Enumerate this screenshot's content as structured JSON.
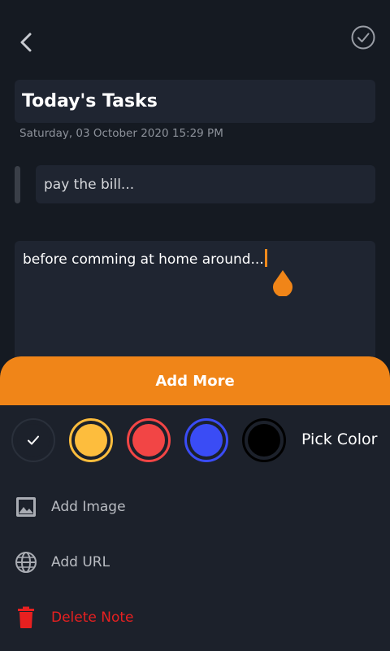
{
  "note": {
    "title": "Today's Tasks",
    "datetime": "Saturday, 03 October 2020 15:29 PM",
    "subtitle": "pay the bill...",
    "body": "before comming at home around..."
  },
  "icons": {
    "back": "chevron-left-icon",
    "done": "check-circle-icon",
    "image": "image-icon",
    "url": "globe-icon",
    "delete": "trash-icon"
  },
  "sheet": {
    "header_label": "Add More",
    "pick_color_label": "Pick Color",
    "colors": [
      {
        "name": "default",
        "hex": "#1c212b",
        "selected": true
      },
      {
        "name": "yellow",
        "hex": "#fdbd3d",
        "selected": false
      },
      {
        "name": "red",
        "hex": "#f24545",
        "selected": false
      },
      {
        "name": "blue",
        "hex": "#3a4cf5",
        "selected": false
      },
      {
        "name": "black",
        "hex": "#000000",
        "selected": false
      }
    ],
    "menu": {
      "add_image": "Add Image",
      "add_url": "Add URL",
      "delete_note": "Delete Note"
    }
  },
  "theme": {
    "accent": "#f08518",
    "danger": "#e82020",
    "background": "#151a22",
    "field": "#1f2531"
  }
}
